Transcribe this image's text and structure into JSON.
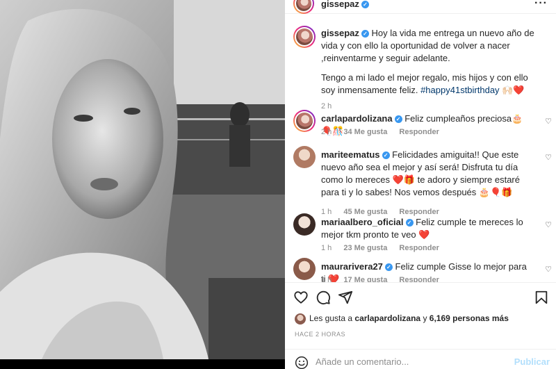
{
  "post": {
    "username": "gissepaz",
    "caption_p1": "Hoy la vida me entrega un nuevo año de vida y con ello la oportunidad de volver a nacer ,reinventarme y seguir adelante.",
    "caption_p2": "Tengo a mi lado el mejor regalo, mis hijos y con ello soy inmensamente feliz.",
    "hashtag": "#happy41stbirthday",
    "caption_emoji": "🙌🏻❤️",
    "time": "2 h"
  },
  "comments": [
    {
      "username": "carlapardolizana",
      "text": "Feliz cumpleaños preciosa🎂🎈🎊",
      "time": "2 h",
      "likes": "34 Me gusta",
      "reply": "Responder"
    },
    {
      "username": "mariteematus",
      "text": "Felicidades amiguita!! Que este nuevo año sea el mejor y así será! Disfruta tu día como lo mereces ❤️🎁 te adoro y siempre estaré para ti y lo sabes! Nos vemos después 🎂🎈🎁",
      "time": "1 h",
      "likes": "45 Me gusta",
      "reply": "Responder"
    },
    {
      "username": "mariaalbero_oficial",
      "text": "Feliz cumple te mereces lo mejor tkm pronto te veo ❤️",
      "time": "1 h",
      "likes": "23 Me gusta",
      "reply": "Responder"
    },
    {
      "username": "maurarivera27",
      "text": "Feliz cumple Gisse lo mejor para ti ❤️",
      "time": "1 h",
      "likes": "17 Me gusta",
      "reply": "Responder"
    }
  ],
  "likes_line": {
    "prefix": "Les gusta a",
    "user": "carlapardolizana",
    "middle": "y",
    "count": "6,169 personas más"
  },
  "timestamp": "HACE 2 HORAS",
  "add_comment": {
    "placeholder": "Añade un comentario...",
    "post_label": "Publicar"
  },
  "icons": [
    "heart-icon",
    "comment-icon",
    "share-icon",
    "bookmark-icon",
    "emoji-icon",
    "more-icon",
    "verified-icon"
  ]
}
